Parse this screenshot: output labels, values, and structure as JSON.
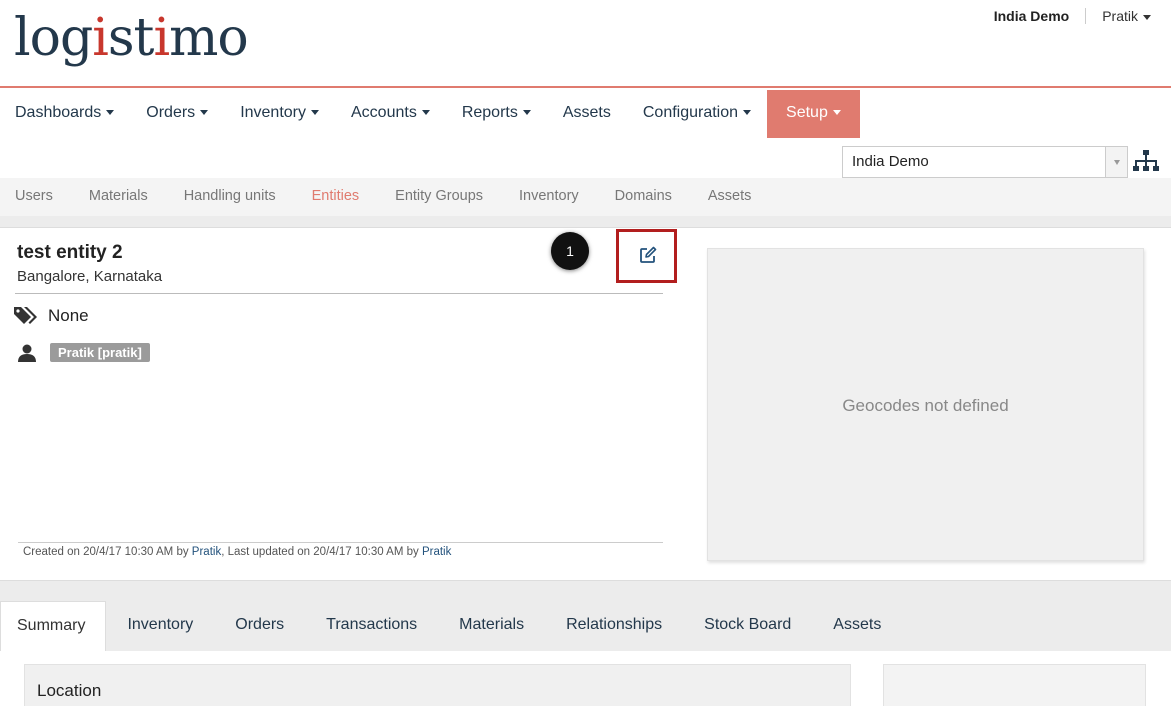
{
  "header": {
    "logo": "logistimo",
    "domain_label": "India Demo",
    "user_menu": "Pratik"
  },
  "main_nav": [
    {
      "label": "Dashboards",
      "has_caret": true
    },
    {
      "label": "Orders",
      "has_caret": true
    },
    {
      "label": "Inventory",
      "has_caret": true
    },
    {
      "label": "Accounts",
      "has_caret": true
    },
    {
      "label": "Reports",
      "has_caret": true
    },
    {
      "label": "Assets",
      "has_caret": false
    },
    {
      "label": "Configuration",
      "has_caret": true
    },
    {
      "label": "Setup",
      "has_caret": true,
      "active": true
    }
  ],
  "domain_select": {
    "value": "India Demo"
  },
  "sub_nav": [
    {
      "label": "Users"
    },
    {
      "label": "Materials"
    },
    {
      "label": "Handling units"
    },
    {
      "label": "Entities",
      "active": true
    },
    {
      "label": "Entity Groups"
    },
    {
      "label": "Inventory"
    },
    {
      "label": "Domains"
    },
    {
      "label": "Assets"
    }
  ],
  "entity": {
    "name": "test entity 2",
    "location": "Bangalore, Karnataka",
    "tags": "None",
    "user": "Pratik [pratik]",
    "step_number": "1",
    "created": {
      "prefix": "Created on 20/4/17 10:30 AM by ",
      "created_by": "Pratik",
      "middle": ", Last updated on 20/4/17 10:30 AM by ",
      "updated_by": "Pratik"
    }
  },
  "map": {
    "message": "Geocodes not defined"
  },
  "tabs": [
    {
      "label": "Summary",
      "active": true
    },
    {
      "label": "Inventory"
    },
    {
      "label": "Orders"
    },
    {
      "label": "Transactions"
    },
    {
      "label": "Materials"
    },
    {
      "label": "Relationships"
    },
    {
      "label": "Stock Board"
    },
    {
      "label": "Assets"
    }
  ],
  "summary": {
    "location_title": "Location"
  },
  "colors": {
    "accent": "#e07b6f",
    "nav_text": "#23384b",
    "highlight_border": "#b21e1e"
  },
  "icons": [
    "edit-icon",
    "tags-icon",
    "user-icon",
    "hierarchy-icon",
    "caret-down-icon"
  ]
}
